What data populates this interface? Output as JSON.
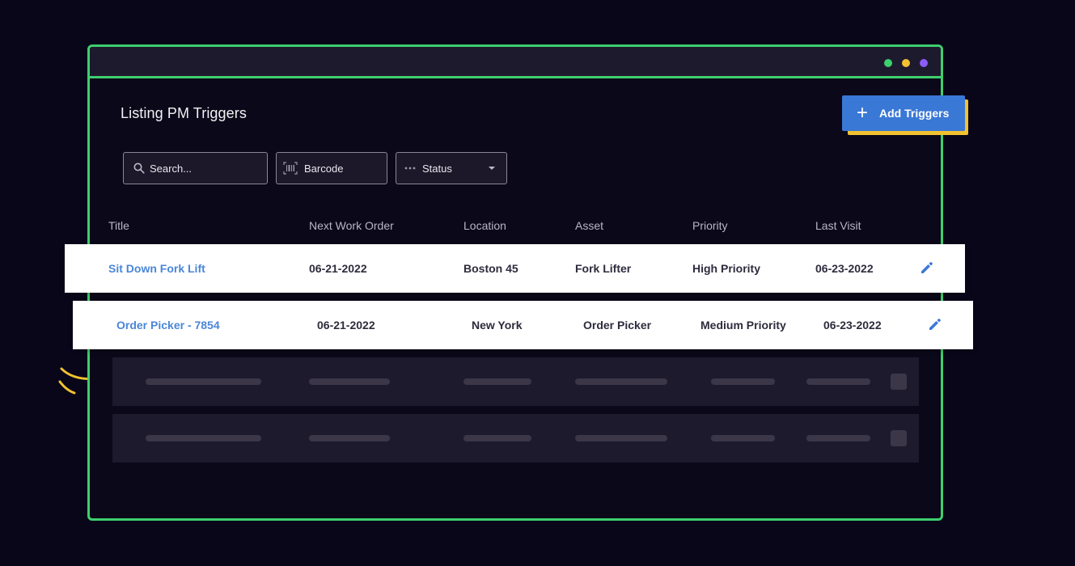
{
  "page": {
    "title": "Listing PM Triggers",
    "add_button_label": "Add Triggers"
  },
  "filters": {
    "search_placeholder": "Search...",
    "barcode_label": "Barcode",
    "status_label": "Status"
  },
  "table": {
    "columns": [
      "Title",
      "Next Work Order",
      "Location",
      "Asset",
      "Priority",
      "Last Visit"
    ],
    "rows": [
      {
        "title": "Sit Down Fork Lift",
        "next_work_order": "06-21-2022",
        "location": "Boston 45",
        "asset": "Fork Lifter",
        "priority": "High Priority",
        "last_visit": "06-23-2022"
      },
      {
        "title": "Order Picker - 7854",
        "next_work_order": "06-21-2022",
        "location": "New York",
        "asset": "Order Picker",
        "priority": "Medium Priority",
        "last_visit": "06-23-2022"
      }
    ]
  },
  "colors": {
    "background": "#09061a",
    "window_border": "#3ecf6e",
    "accent_blue": "#3a78d6",
    "accent_yellow": "#f2c230",
    "dot_purple": "#8b5cf6"
  },
  "icons": {
    "search": "search-icon",
    "barcode": "barcode-icon",
    "status": "more-dots-icon",
    "edit": "pencil-icon",
    "add": "plus-icon"
  }
}
